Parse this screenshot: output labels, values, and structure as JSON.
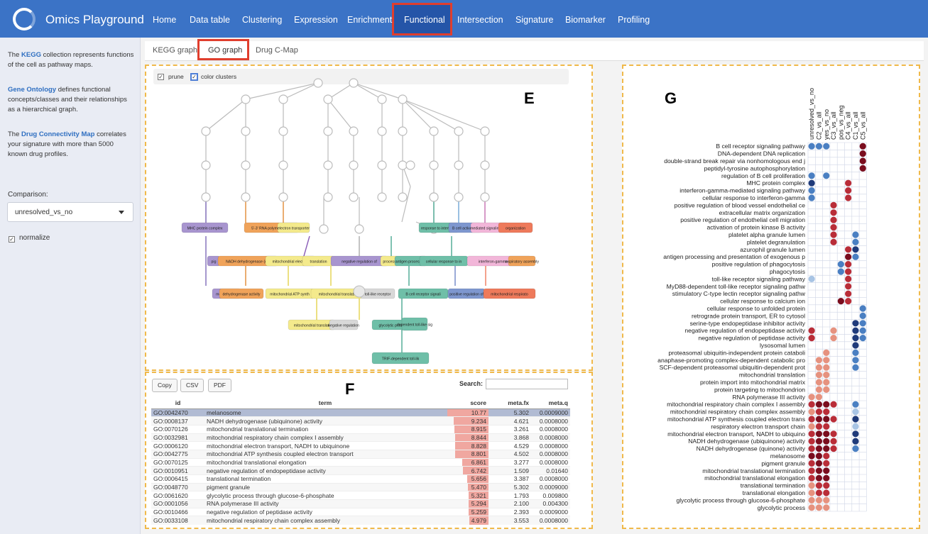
{
  "app": {
    "title": "Omics Playground"
  },
  "nav": [
    "Home",
    "Data table",
    "Clustering",
    "Expression",
    "Enrichment",
    "Functional",
    "Intersection",
    "Signature",
    "Biomarker",
    "Profiling"
  ],
  "sidebar": {
    "para1_link": "KEGG",
    "para1_pre": "The ",
    "para1_rest": " collection represents functions of the cell as pathway maps.",
    "para2_link": "Gene Ontology",
    "para2_rest": " defines functional concepts/classes and their relationships as a hierarchical graph.",
    "para3_link": "Drug Connectivity Map",
    "para3_pre": "The ",
    "para3_rest": " correlates your signature with more than 5000 known drug profiles.",
    "comparison_label": "Comparison:",
    "comparison_value": "unresolved_vs_no",
    "normalize_label": "normalize"
  },
  "tabs": [
    "KEGG graph",
    "GO graph",
    "Drug C-Map"
  ],
  "panel_letters": {
    "e": "E",
    "f": "F",
    "g": "G"
  },
  "graph_controls": {
    "prune": "prune",
    "color_clusters": "color clusters"
  },
  "graph_nodes": [
    "MHC protein complex",
    "5'-3' RNA polymerase activity",
    "electron transporter",
    "response to interferon",
    "B cell activation",
    "mediated signaling pathway",
    "organization",
    "pig",
    "NADH dehydrogenase (quinone) activity",
    "mitochondrial electron transport, NADH to",
    "translation",
    "negative regulation of proteolysis",
    "process",
    "antigen processing",
    "cellular response to interferon-gamma",
    "interferon-gamma-mediated signaling pathway",
    "respiratory assembly",
    "melanosome",
    "dehydrogenase activity",
    "mitochondrial ATP synthesis coupled electron transport",
    "mitochondrial translational elongation",
    "toll-like receptor",
    "B cell receptor signaling pathway",
    "positive regulation of cell proliferation",
    "mitochondrial respiratory chain complex I assembly",
    "mitochondrial translational termination",
    "negative regulation",
    "glycolytic process through glucose-6-phosphate",
    "dependent toll-like signaling path",
    "TRIF-dependent toll-like receptor signaling pathway"
  ],
  "table": {
    "buttons": [
      "Copy",
      "CSV",
      "PDF"
    ],
    "search_label": "Search:",
    "columns": [
      "id",
      "term",
      "score",
      "meta.fx",
      "meta.q"
    ],
    "rows": [
      [
        "GO:0042470",
        "melanosome",
        "10.77",
        "5.302",
        "0.0009000"
      ],
      [
        "GO:0008137",
        "NADH dehydrogenase (ubiquinone) activity",
        "9.234",
        "4.621",
        "0.0008000"
      ],
      [
        "GO:0070126",
        "mitochondrial translational termination",
        "8.915",
        "3.261",
        "0.0008000"
      ],
      [
        "GO:0032981",
        "mitochondrial respiratory chain complex I assembly",
        "8.844",
        "3.868",
        "0.0008000"
      ],
      [
        "GO:0006120",
        "mitochondrial electron transport, NADH to ubiquinone",
        "8.828",
        "4.529",
        "0.0008000"
      ],
      [
        "GO:0042775",
        "mitochondrial ATP synthesis coupled electron transport",
        "8.801",
        "4.502",
        "0.0008000"
      ],
      [
        "GO:0070125",
        "mitochondrial translational elongation",
        "6.861",
        "3.277",
        "0.0008000"
      ],
      [
        "GO:0010951",
        "negative regulation of endopeptidase activity",
        "6.742",
        "1.509",
        "0.01640"
      ],
      [
        "GO:0006415",
        "translational termination",
        "5.656",
        "3.387",
        "0.0008000"
      ],
      [
        "GO:0048770",
        "pigment granule",
        "5.470",
        "5.302",
        "0.0009000"
      ],
      [
        "GO:0061620",
        "glycolytic process through glucose-6-phosphate",
        "5.321",
        "1.793",
        "0.009800"
      ],
      [
        "GO:0001056",
        "RNA polymerase III activity",
        "5.294",
        "2.100",
        "0.004300"
      ],
      [
        "GO:0010466",
        "negative regulation of peptidase activity",
        "5.259",
        "2.393",
        "0.0009000"
      ],
      [
        "GO:0033108",
        "mitochondrial respiratory chain complex assembly",
        "4.979",
        "3.553",
        "0.0008000"
      ]
    ]
  },
  "dotplot": {
    "columns": [
      "unresolved_vs_no",
      "C2_vs_all",
      "yes_vs_no",
      "C3_vs_all",
      "pos_vs_neg",
      "C4_vs_all",
      "C1_vs_all",
      "C5_vs_all"
    ],
    "rows": [
      "B cell receptor signaling pathway",
      "DNA-dependent DNA replication",
      "double-strand break repair via nonhomologous end j",
      "peptidyl-tyrosine autophosphorylation",
      "regulation of B cell proliferation",
      "MHC protein complex",
      "interferon-gamma-mediated signaling pathway",
      "cellular response to interferon-gamma",
      "positive regulation of blood vessel endothelial ce",
      "extracellular matrix organization",
      "positive regulation of endothelial cell migration",
      "activation of protein kinase B activity",
      "platelet alpha granule lumen",
      "platelet degranulation",
      "azurophil granule lumen",
      "antigen processing and presentation of exogenous p",
      "positive regulation of phagocytosis",
      "phagocytosis",
      "toll-like receptor signaling pathway",
      "MyD88-dependent toll-like receptor signaling pathw",
      "stimulatory C-type lectin receptor signaling pathw",
      "cellular response to calcium ion",
      "cellular response to unfolded protein",
      "retrograde protein transport, ER to cytosol",
      "serine-type endopeptidase inhibitor activity",
      "negative regulation of endopeptidase activity",
      "negative regulation of peptidase activity",
      "lysosomal lumen",
      "proteasomal ubiquitin-independent protein cataboli",
      "anaphase-promoting complex-dependent catabolic pro",
      "SCF-dependent proteasomal ubiquitin-dependent prot",
      "mitochondrial translation",
      "protein import into mitochondrial matrix",
      "protein targeting to mitochondrion",
      "RNA polymerase III activity",
      "mitochondrial respiratory chain complex I assembly",
      "mitochondrial respiratory chain complex assembly",
      "mitochondrial ATP synthesis coupled electron trans",
      "respiratory electron transport chain",
      "mitochondrial electron transport, NADH to ubiquino",
      "NADH dehydrogenase (ubiquinone) activity",
      "NADH dehydrogenase (quinone) activity",
      "melanosome",
      "pigment granule",
      "mitochondrial translational termination",
      "mitochondrial translational elongation",
      "translational termination",
      "translational elongation",
      "glycolytic process through glucose-6-phosphate",
      "glycolytic process"
    ],
    "dots": [
      [
        0,
        0,
        -2
      ],
      [
        1,
        0,
        -2
      ],
      [
        2,
        0,
        -2
      ],
      [
        7,
        0,
        3
      ],
      [
        7,
        1,
        3
      ],
      [
        7,
        2,
        3
      ],
      [
        7,
        3,
        3
      ],
      [
        0,
        4,
        -2
      ],
      [
        2,
        4,
        -2
      ],
      [
        0,
        5,
        -3
      ],
      [
        5,
        5,
        2
      ],
      [
        0,
        6,
        -2
      ],
      [
        5,
        6,
        2
      ],
      [
        0,
        7,
        -2
      ],
      [
        5,
        7,
        2
      ],
      [
        3,
        8,
        2
      ],
      [
        3,
        9,
        2
      ],
      [
        3,
        10,
        2
      ],
      [
        3,
        11,
        2
      ],
      [
        3,
        12,
        2
      ],
      [
        6,
        12,
        -2
      ],
      [
        3,
        13,
        2
      ],
      [
        6,
        13,
        -2
      ],
      [
        5,
        14,
        2
      ],
      [
        6,
        14,
        -3
      ],
      [
        5,
        15,
        3
      ],
      [
        6,
        15,
        -2
      ],
      [
        5,
        16,
        2
      ],
      [
        4,
        16,
        -2
      ],
      [
        4,
        17,
        -2
      ],
      [
        5,
        17,
        2
      ],
      [
        0,
        18,
        -1
      ],
      [
        5,
        18,
        2
      ],
      [
        5,
        19,
        2
      ],
      [
        5,
        20,
        2
      ],
      [
        4,
        21,
        3
      ],
      [
        5,
        21,
        2
      ],
      [
        7,
        22,
        -2
      ],
      [
        7,
        23,
        -2
      ],
      [
        6,
        24,
        -3
      ],
      [
        7,
        24,
        -2
      ],
      [
        0,
        25,
        2
      ],
      [
        3,
        25,
        1
      ],
      [
        6,
        25,
        -3
      ],
      [
        7,
        25,
        -2
      ],
      [
        0,
        26,
        2
      ],
      [
        3,
        26,
        1
      ],
      [
        6,
        26,
        -3
      ],
      [
        7,
        26,
        -2
      ],
      [
        6,
        27,
        -3
      ],
      [
        2,
        28,
        1
      ],
      [
        6,
        28,
        -2
      ],
      [
        1,
        29,
        1
      ],
      [
        2,
        29,
        1
      ],
      [
        6,
        29,
        -2
      ],
      [
        1,
        30,
        1
      ],
      [
        2,
        30,
        1
      ],
      [
        6,
        30,
        -2
      ],
      [
        1,
        31,
        1
      ],
      [
        2,
        31,
        1
      ],
      [
        1,
        32,
        1
      ],
      [
        2,
        32,
        1
      ],
      [
        1,
        33,
        1
      ],
      [
        2,
        33,
        1
      ],
      [
        0,
        34,
        1
      ],
      [
        1,
        34,
        1
      ],
      [
        0,
        35,
        2
      ],
      [
        1,
        35,
        3
      ],
      [
        2,
        35,
        3
      ],
      [
        3,
        35,
        2
      ],
      [
        6,
        35,
        -2
      ],
      [
        0,
        36,
        1
      ],
      [
        1,
        36,
        2
      ],
      [
        2,
        36,
        2
      ],
      [
        6,
        36,
        -1
      ],
      [
        0,
        37,
        2
      ],
      [
        1,
        37,
        3
      ],
      [
        2,
        37,
        3
      ],
      [
        3,
        37,
        2
      ],
      [
        6,
        37,
        -3
      ],
      [
        0,
        38,
        1
      ],
      [
        1,
        38,
        2
      ],
      [
        2,
        38,
        2
      ],
      [
        6,
        38,
        -1
      ],
      [
        0,
        39,
        2
      ],
      [
        1,
        39,
        3
      ],
      [
        2,
        39,
        3
      ],
      [
        3,
        39,
        2
      ],
      [
        6,
        39,
        -3
      ],
      [
        0,
        40,
        2
      ],
      [
        1,
        40,
        3
      ],
      [
        2,
        40,
        3
      ],
      [
        3,
        40,
        2
      ],
      [
        6,
        40,
        -3
      ],
      [
        0,
        41,
        2
      ],
      [
        1,
        41,
        3
      ],
      [
        2,
        41,
        3
      ],
      [
        3,
        41,
        2
      ],
      [
        6,
        41,
        -2
      ],
      [
        0,
        42,
        3
      ],
      [
        1,
        42,
        3
      ],
      [
        2,
        42,
        2
      ],
      [
        0,
        43,
        2
      ],
      [
        1,
        43,
        3
      ],
      [
        2,
        43,
        2
      ],
      [
        0,
        44,
        2
      ],
      [
        1,
        44,
        3
      ],
      [
        2,
        44,
        3
      ],
      [
        0,
        45,
        2
      ],
      [
        1,
        45,
        3
      ],
      [
        2,
        45,
        3
      ],
      [
        0,
        46,
        1
      ],
      [
        1,
        46,
        2
      ],
      [
        2,
        46,
        2
      ],
      [
        0,
        47,
        1
      ],
      [
        1,
        47,
        2
      ],
      [
        2,
        47,
        2
      ],
      [
        0,
        48,
        1
      ],
      [
        1,
        48,
        1
      ],
      [
        2,
        48,
        1
      ],
      [
        0,
        49,
        1
      ],
      [
        1,
        49,
        1
      ],
      [
        2,
        49,
        1
      ]
    ]
  }
}
